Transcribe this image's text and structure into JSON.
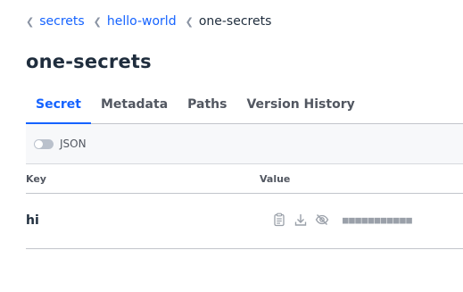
{
  "breadcrumb": {
    "items": [
      {
        "label": "secrets"
      },
      {
        "label": "hello-world"
      },
      {
        "label": "one-secrets"
      }
    ]
  },
  "page": {
    "title": "one-secrets"
  },
  "tabs": [
    {
      "label": "Secret",
      "active": true
    },
    {
      "label": "Metadata",
      "active": false
    },
    {
      "label": "Paths",
      "active": false
    },
    {
      "label": "Version History",
      "active": false
    }
  ],
  "toolbar": {
    "json_toggle_label": "JSON",
    "json_toggle_on": false
  },
  "table": {
    "headers": {
      "key": "Key",
      "value": "Value"
    },
    "rows": [
      {
        "key": "hi",
        "masked_value": "■■■■■■■■■■■",
        "icons": [
          "copy-icon",
          "download-icon",
          "eye-slash-icon"
        ]
      }
    ]
  },
  "colors": {
    "accent": "#1563ff",
    "text": "#1f2d3d",
    "muted": "#525761",
    "border": "#c2c5cb"
  }
}
